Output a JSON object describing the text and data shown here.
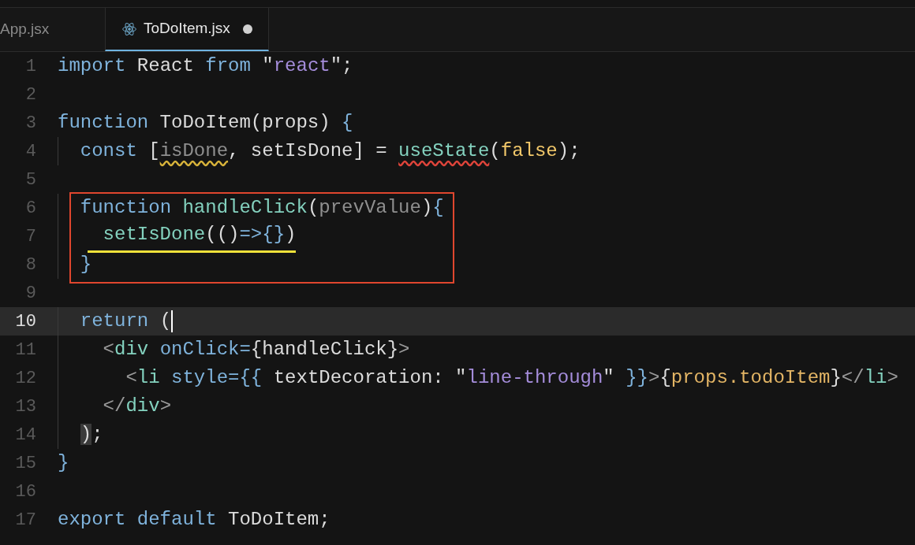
{
  "tabs": [
    {
      "label": "App.jsx",
      "selected": false,
      "modified": false,
      "icon": false
    },
    {
      "label": "ToDoItem.jsx",
      "selected": true,
      "modified": true,
      "icon": true
    }
  ],
  "lines": [
    {
      "number": "1",
      "tokens": [
        {
          "kind": "kw",
          "text": "import"
        },
        {
          "kind": "plain",
          "text": " React "
        },
        {
          "kind": "kw",
          "text": "from"
        },
        {
          "kind": "plain",
          "text": " \""
        },
        {
          "kind": "str",
          "text": "react"
        },
        {
          "kind": "plain",
          "text": "\";"
        }
      ]
    },
    {
      "number": "2"
    },
    {
      "number": "3",
      "tokens": [
        {
          "kind": "kw",
          "text": "function"
        },
        {
          "kind": "plain",
          "text": " ToDoItem(props) "
        },
        {
          "kind": "kw",
          "text": "{"
        }
      ]
    },
    {
      "number": "4",
      "tokens": [
        {
          "kind": "kw",
          "text": "  const"
        },
        {
          "kind": "plain",
          "text": " ["
        },
        {
          "kind": "unused",
          "text": "isDone",
          "warning": true
        },
        {
          "kind": "plain",
          "text": ", setIsDone] = "
        },
        {
          "kind": "fn",
          "text": "useState",
          "error": true
        },
        {
          "kind": "plain",
          "text": "("
        },
        {
          "kind": "bool",
          "text": "false"
        },
        {
          "kind": "plain",
          "text": ");"
        }
      ]
    },
    {
      "number": "5"
    },
    {
      "number": "6",
      "boxed": true,
      "tokens": [
        {
          "kind": "kw",
          "text": "  function "
        },
        {
          "kind": "fn",
          "text": "handleClick"
        },
        {
          "kind": "plain",
          "text": "("
        },
        {
          "kind": "param",
          "text": "prevValue"
        },
        {
          "kind": "plain",
          "text": ")"
        },
        {
          "kind": "kw",
          "text": "{"
        }
      ]
    },
    {
      "number": "7",
      "boxed": true,
      "underlined": true,
      "tokens": [
        {
          "kind": "fn",
          "text": "    setIsDone"
        },
        {
          "kind": "plain",
          "text": "(()"
        },
        {
          "kind": "kw",
          "text": "=>{}"
        },
        {
          "kind": "plain",
          "text": ")"
        }
      ]
    },
    {
      "number": "8",
      "boxed": true,
      "tokens": [
        {
          "kind": "kw",
          "text": "  }"
        }
      ]
    },
    {
      "number": "9"
    },
    {
      "number": "10",
      "current": true,
      "tokens": [
        {
          "kind": "kw",
          "text": "  return"
        },
        {
          "kind": "plain",
          "text": " ("
        }
      ]
    },
    {
      "number": "11",
      "tokens": [
        {
          "kind": "punct",
          "text": "    <"
        },
        {
          "kind": "tag",
          "text": "div "
        },
        {
          "kind": "attr",
          "text": "onClick"
        },
        {
          "kind": "kw",
          "text": "="
        },
        {
          "kind": "plain",
          "text": "{handleClick}"
        },
        {
          "kind": "punct",
          "text": ">"
        }
      ]
    },
    {
      "number": "12",
      "tokens": [
        {
          "kind": "punct",
          "text": "      <"
        },
        {
          "kind": "tag",
          "text": "li "
        },
        {
          "kind": "attr",
          "text": "style"
        },
        {
          "kind": "kw",
          "text": "={{"
        },
        {
          "kind": "plain",
          "text": " textDecoration: \""
        },
        {
          "kind": "str",
          "text": "line-through"
        },
        {
          "kind": "plain",
          "text": "\" "
        },
        {
          "kind": "kw",
          "text": "}}"
        },
        {
          "kind": "punct",
          "text": ">"
        },
        {
          "kind": "plain",
          "text": "{"
        },
        {
          "kind": "prop",
          "text": "props.todoItem"
        },
        {
          "kind": "plain",
          "text": "}"
        },
        {
          "kind": "punct",
          "text": "</"
        },
        {
          "kind": "tag",
          "text": "li"
        },
        {
          "kind": "punct",
          "text": ">"
        }
      ]
    },
    {
      "number": "13",
      "tokens": [
        {
          "kind": "punct",
          "text": "    </"
        },
        {
          "kind": "tag",
          "text": "div"
        },
        {
          "kind": "punct",
          "text": ">"
        }
      ]
    },
    {
      "number": "14",
      "tokens": [
        {
          "kind": "plain",
          "text": "  )",
          "bracket_match": true
        },
        {
          "kind": "plain",
          "text": ";"
        }
      ]
    },
    {
      "number": "15",
      "tokens": [
        {
          "kind": "kw",
          "text": "}"
        }
      ]
    },
    {
      "number": "16"
    },
    {
      "number": "17",
      "tokens": [
        {
          "kind": "kw",
          "text": "export default"
        },
        {
          "kind": "plain",
          "text": " ToDoItem;"
        }
      ]
    }
  ]
}
